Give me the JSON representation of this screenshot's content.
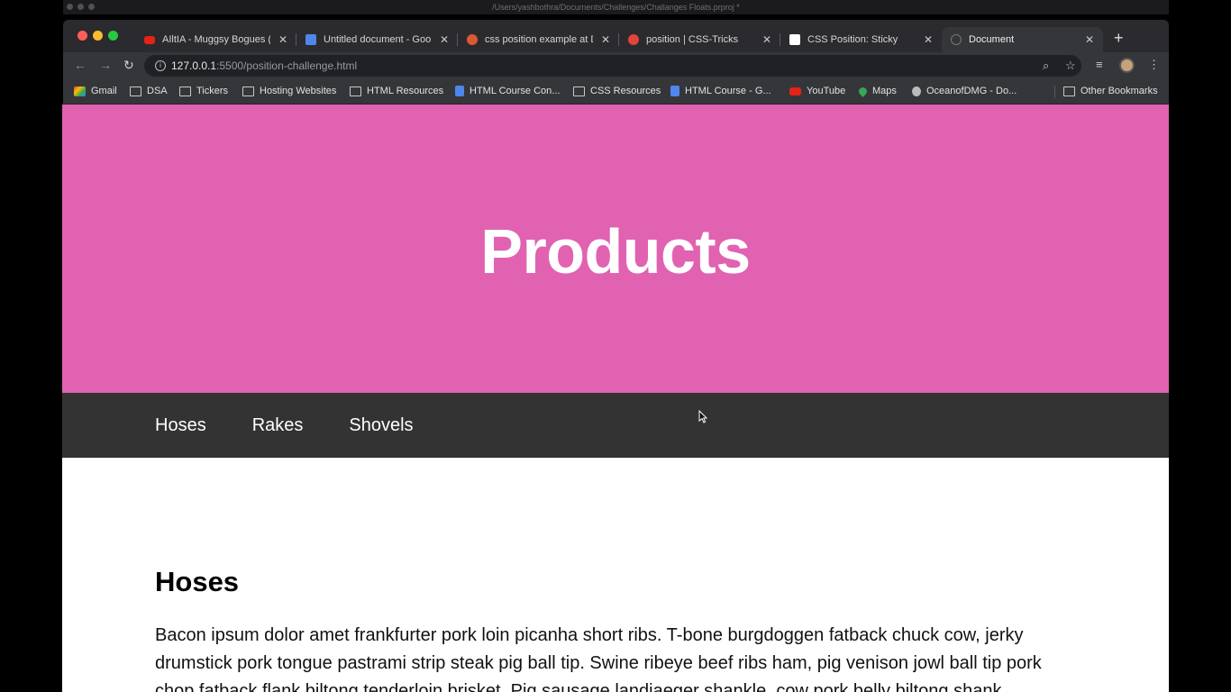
{
  "outer_window": {
    "title": "/Users/yashbothra/Documents/Challenges/Challanges Floats.prproj *"
  },
  "browser": {
    "tabs": [
      {
        "title": "AIltIA - Muggsy Bogues (",
        "icon": "youtube-icon"
      },
      {
        "title": "Untitled document - Goo",
        "icon": "google-docs-icon"
      },
      {
        "title": "css position example at D",
        "icon": "duckduckgo-icon"
      },
      {
        "title": "position | CSS-Tricks",
        "icon": "css-tricks-icon"
      },
      {
        "title": "CSS Position: Sticky",
        "icon": "sticky-icon"
      },
      {
        "title": "Document",
        "icon": "globe-icon"
      }
    ],
    "url_host": "127.0.0.1",
    "url_rest": ":5500/position-challenge.html",
    "bookmarks": [
      {
        "label": "Gmail",
        "icon": "gmail-icon"
      },
      {
        "label": "DSA",
        "icon": "folder-icon"
      },
      {
        "label": "Tickers",
        "icon": "folder-icon"
      },
      {
        "label": "Hosting Websites",
        "icon": "folder-icon"
      },
      {
        "label": "HTML Resources",
        "icon": "folder-icon"
      },
      {
        "label": "HTML Course Con...",
        "icon": "google-docs-icon"
      },
      {
        "label": "CSS Resources",
        "icon": "folder-icon"
      },
      {
        "label": "HTML Course - G...",
        "icon": "google-docs-icon"
      },
      {
        "label": "YouTube",
        "icon": "youtube-icon"
      },
      {
        "label": "Maps",
        "icon": "maps-icon"
      },
      {
        "label": "OceanofDMG - Do...",
        "icon": "apple-icon"
      }
    ],
    "other_bookmarks": "Other Bookmarks"
  },
  "page": {
    "hero_title": "Products",
    "hero_color": "#e062b1",
    "nav": [
      "Hoses",
      "Rakes",
      "Shovels"
    ],
    "nav_color": "#333333",
    "section_title": "Hoses",
    "section_text": "Bacon ipsum dolor amet frankfurter pork loin picanha short ribs. T-bone burgdoggen fatback chuck cow, jerky drumstick pork tongue pastrami strip steak pig ball tip. Swine ribeye beef ribs ham, pig venison jowl ball tip pork chop fatback flank biltong tenderloin brisket. Pig sausage landjaeger shankle, cow pork belly biltong shank"
  }
}
